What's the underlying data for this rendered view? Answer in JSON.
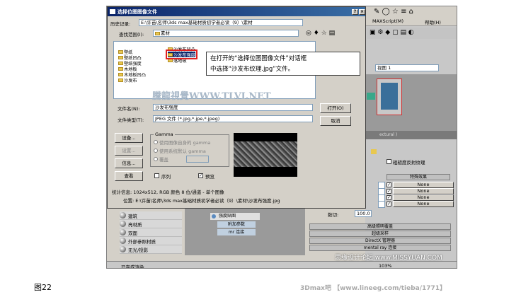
{
  "dialog": {
    "title": "选择位图图像文件",
    "history_label": "历史记录:",
    "history_value": "E:\\许苗\\名师\\3ds max基础材质初学者必读（9）\\素材",
    "lookin_label": "查找范围(I):",
    "lookin_value": "素材",
    "folders_col1": [
      "壁纸",
      "壁纸凹凸",
      "壁纸强度",
      "木地板",
      "木地板凹凸",
      "沙发布"
    ],
    "folders_col2": [
      "沙发布凹凸",
      "沙发布强度",
      "落地玻"
    ],
    "filename_label": "文件名(N):",
    "filename_value": "沙发布强度",
    "filetype_label": "文件类型(T):",
    "filetype_value": "JPEG 文件 (*.jpg,*.jpe,*.jpeg)",
    "open_button": "打开(O)",
    "cancel_button": "取消",
    "setup_button": "设备...",
    "settings_button": "设置...",
    "info_button": "信息...",
    "view_button": "查看",
    "gamma_title": "Gamma",
    "gamma_opt1": "使用图像自身的 gamma",
    "gamma_opt2": "使用系统默认 gamma",
    "gamma_opt3": "覆盖",
    "sequence_label": "序列",
    "preview_label": "预览",
    "stats_text": "统计信息: 1024x512, RGB 颜色 8 位/通道 - 单个图像",
    "location_text": "位置: E:\\许苗\\名师\\3ds max基础材质初学者必读（9）\\素材\\沙发布强度.jpg"
  },
  "callout": {
    "line1": "在打开的“选择位图图像文件”对话框",
    "line2": "中选择“沙发布纹理.jpg”文件。"
  },
  "watermark": "騰龍視覺WWW.TLVI.NET",
  "bg_app": {
    "menu1": "MAXScript(M)",
    "menu2": "帮助(H)",
    "view_dropdown": "视图 1",
    "rollout_title": "ectural )",
    "checkbox_label": "粗糙度反射纹理",
    "special_effects": "特殊效果",
    "none_labels": [
      "None",
      "None",
      "None",
      "None"
    ],
    "amount_label": "数切:",
    "amount_value": "100.0",
    "rollouts": [
      "高级照明覆盖",
      "超级采样",
      "DirectX 管理器",
      "mental ray 连接"
    ],
    "mat_list": [
      "建筑",
      "亮材质",
      "双面",
      "外部参照材质",
      "无光/投影"
    ],
    "node_labels": [
      "强度贴图",
      "附加参数",
      "mr 连接"
    ],
    "status_text": "已完成渲染",
    "zoom_text": "103%"
  },
  "footer": {
    "caption": "图22",
    "credit_right": "3Dmax吧 【www.lineeg.com/tieba/1771】",
    "site_watermark": "思缘设计论坛 www.MISSYUAN.COM"
  }
}
